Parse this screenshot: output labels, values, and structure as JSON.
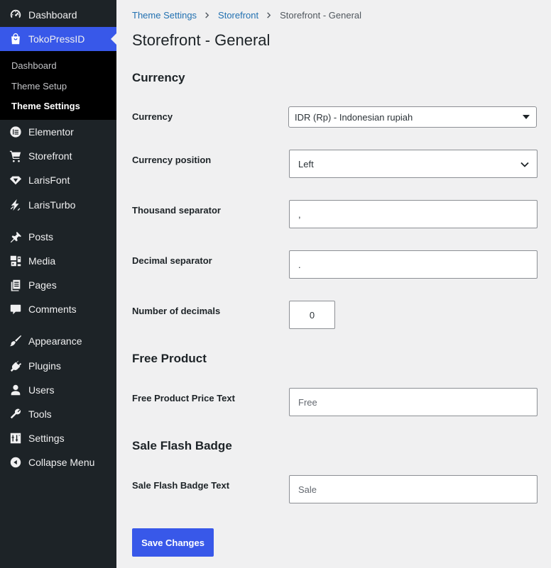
{
  "sidebar": {
    "items": [
      {
        "label": "Dashboard",
        "icon": "dashboard-icon"
      },
      {
        "label": "TokoPressID",
        "icon": "shopping-bag-icon",
        "active": true
      },
      {
        "label": "Elementor",
        "icon": "elementor-icon"
      },
      {
        "label": "Storefront",
        "icon": "cart-icon"
      },
      {
        "label": "LarisFont",
        "icon": "diamond-icon"
      },
      {
        "label": "LarisTurbo",
        "icon": "bolt-icon"
      },
      {
        "label": "Posts",
        "icon": "pin-icon"
      },
      {
        "label": "Media",
        "icon": "media-icon"
      },
      {
        "label": "Pages",
        "icon": "pages-icon"
      },
      {
        "label": "Comments",
        "icon": "comment-icon"
      },
      {
        "label": "Appearance",
        "icon": "brush-icon"
      },
      {
        "label": "Plugins",
        "icon": "plug-icon"
      },
      {
        "label": "Users",
        "icon": "user-icon"
      },
      {
        "label": "Tools",
        "icon": "wrench-icon"
      },
      {
        "label": "Settings",
        "icon": "settings-icon"
      },
      {
        "label": "Collapse Menu",
        "icon": "collapse-icon"
      }
    ],
    "submenu": [
      {
        "label": "Dashboard"
      },
      {
        "label": "Theme Setup"
      },
      {
        "label": "Theme Settings",
        "current": true
      }
    ]
  },
  "breadcrumb": {
    "items": [
      "Theme Settings",
      "Storefront",
      "Storefront - General"
    ]
  },
  "page": {
    "title": "Storefront - General"
  },
  "sections": {
    "currency_title": "Currency",
    "free_product_title": "Free Product",
    "sale_flash_title": "Sale Flash Badge"
  },
  "fields": {
    "currency": {
      "label": "Currency",
      "value": "IDR (Rp) - Indonesian rupiah"
    },
    "currency_position": {
      "label": "Currency position",
      "value": "Left"
    },
    "thousand_separator": {
      "label": "Thousand separator",
      "value": ","
    },
    "decimal_separator": {
      "label": "Decimal separator",
      "value": "."
    },
    "number_of_decimals": {
      "label": "Number of decimals",
      "value": "0"
    },
    "free_product_text": {
      "label": "Free Product Price Text",
      "value": "Free"
    },
    "sale_flash_text": {
      "label": "Sale Flash Badge Text",
      "value": "Sale"
    }
  },
  "actions": {
    "save_label": "Save Changes"
  },
  "colors": {
    "sidebar_bg": "#1d2327",
    "accent": "#3858e9",
    "link": "#2271b1"
  }
}
